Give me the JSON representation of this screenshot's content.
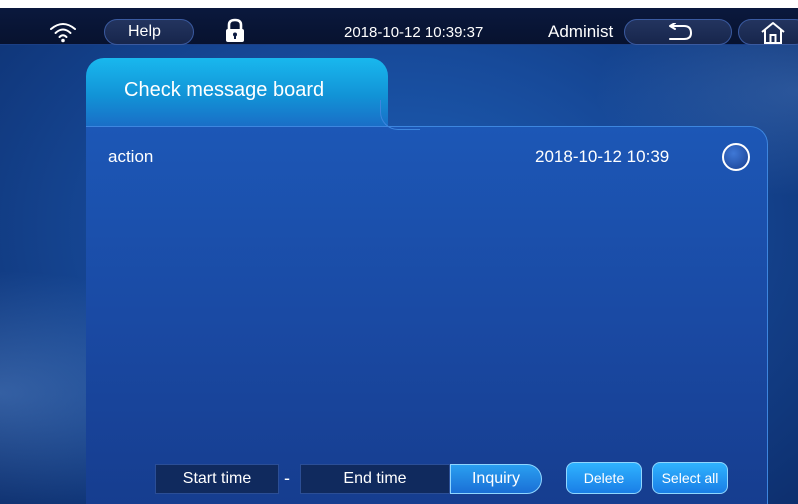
{
  "topbar": {
    "help_label": "Help",
    "datetime": "2018-10-12 10:39:37",
    "user": "Administ"
  },
  "tab": {
    "label": "Check message board"
  },
  "message": {
    "type": "action",
    "time": "2018-10-12 10:39"
  },
  "filter": {
    "start_time": "Start time",
    "separator": "-",
    "end_time": "End time",
    "inquiry": "Inquiry"
  },
  "buttons": {
    "delete": "Delete",
    "select_all": "Select all"
  },
  "icons": {
    "wifi": "wifi-icon",
    "lock": "lock-icon",
    "back": "back-icon",
    "home": "home-icon"
  },
  "colors": {
    "accent": "#1a9fe6",
    "background": "#174a9a",
    "topbar": "#07122f"
  }
}
